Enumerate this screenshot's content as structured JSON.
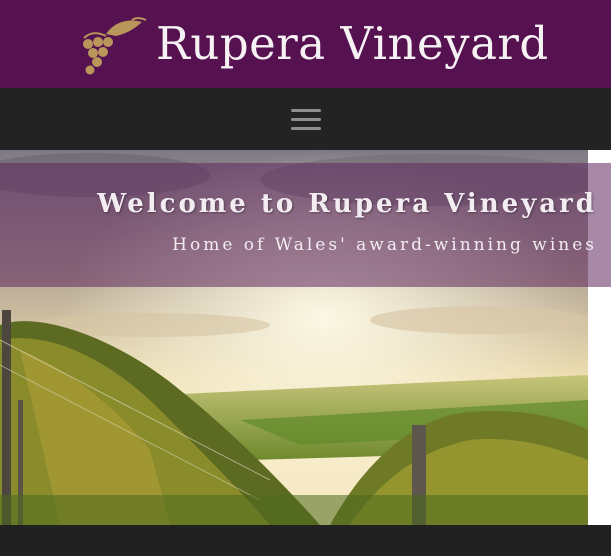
{
  "brand": {
    "title": "Rupera Vineyard",
    "logo_icon": "grape-cluster-icon",
    "background_color": "#561250"
  },
  "nav": {
    "menu_icon": "hamburger-menu-icon",
    "menu_label": "Toggle navigation"
  },
  "hero": {
    "heading": "Welcome to Rupera Vineyard",
    "subheading": "Home of Wales' award-winning wines",
    "image": "vineyard-sunset-photo"
  }
}
